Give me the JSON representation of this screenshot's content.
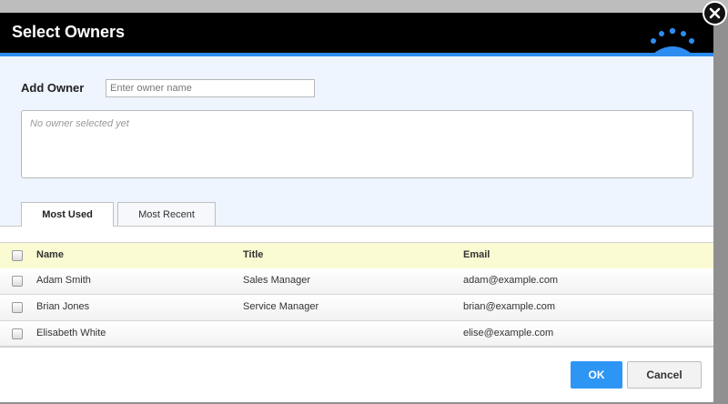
{
  "dialog": {
    "title": "Select Owners",
    "close_icon": "close-icon",
    "brand_icon": "crown-logo-icon"
  },
  "add_owner": {
    "label": "Add Owner",
    "placeholder": "Enter owner name",
    "value": "",
    "empty_text": "No owner selected yet"
  },
  "tabs": [
    {
      "label": "Most Used",
      "active": true
    },
    {
      "label": "Most Recent",
      "active": false
    }
  ],
  "table": {
    "columns": [
      "Name",
      "Title",
      "Email"
    ],
    "rows": [
      {
        "name": "Adam Smith",
        "title": "Sales Manager",
        "email": "adam@example.com"
      },
      {
        "name": "Brian Jones",
        "title": "Service Manager",
        "email": "brian@example.com"
      },
      {
        "name": "Elisabeth White",
        "title": "",
        "email": "elise@example.com"
      }
    ]
  },
  "buttons": {
    "ok": "OK",
    "cancel": "Cancel"
  },
  "colors": {
    "header_bg": "#000000",
    "accent": "#2d8cf0",
    "ok_button": "#2d96f5",
    "panel_bg": "#eef5ff",
    "table_header_bg": "#fbfbd3"
  }
}
